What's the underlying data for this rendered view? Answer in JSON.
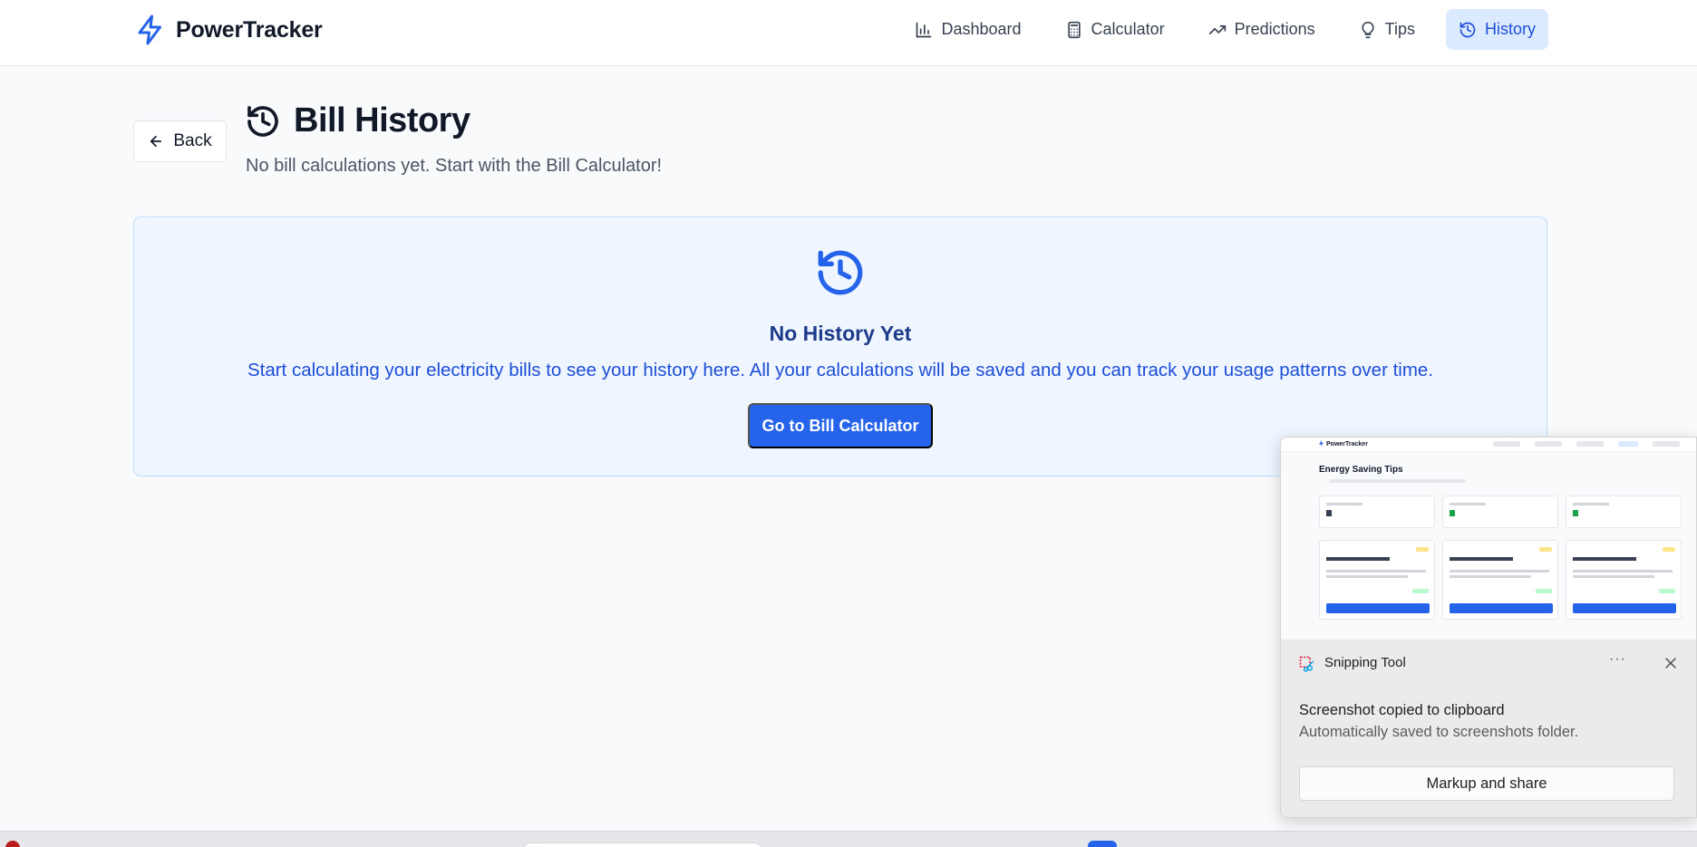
{
  "brand": {
    "name": "PowerTracker"
  },
  "nav": {
    "items": [
      {
        "label": "Dashboard",
        "icon": "bar-chart-icon",
        "active": false
      },
      {
        "label": "Calculator",
        "icon": "calculator-icon",
        "active": false
      },
      {
        "label": "Predictions",
        "icon": "trending-up-icon",
        "active": false
      },
      {
        "label": "Tips",
        "icon": "lightbulb-icon",
        "active": false
      },
      {
        "label": "History",
        "icon": "history-icon",
        "active": true
      }
    ]
  },
  "header": {
    "back_label": "Back",
    "title": "Bill History",
    "subtitle": "No bill calculations yet. Start with the Bill Calculator!"
  },
  "empty_state": {
    "title": "No History Yet",
    "description": "Start calculating your electricity bills to see your history here. All your calculations will be saved and you can track your usage patterns over time.",
    "cta_label": "Go to Bill Calculator"
  },
  "snipping_tool": {
    "app_name": "Snipping Tool",
    "message": "Screenshot copied to clipboard",
    "detail": "Automatically saved to screenshots folder.",
    "action_label": "Markup and share",
    "preview": {
      "brand": "PowerTracker",
      "title": "Energy Saving Tips"
    }
  },
  "colors": {
    "accent": "#2563eb",
    "active_nav_bg": "#dbeafe",
    "empty_bg": "#eff6ff",
    "empty_title": "#1e3a8a",
    "page_bg": "#f8fafc"
  }
}
